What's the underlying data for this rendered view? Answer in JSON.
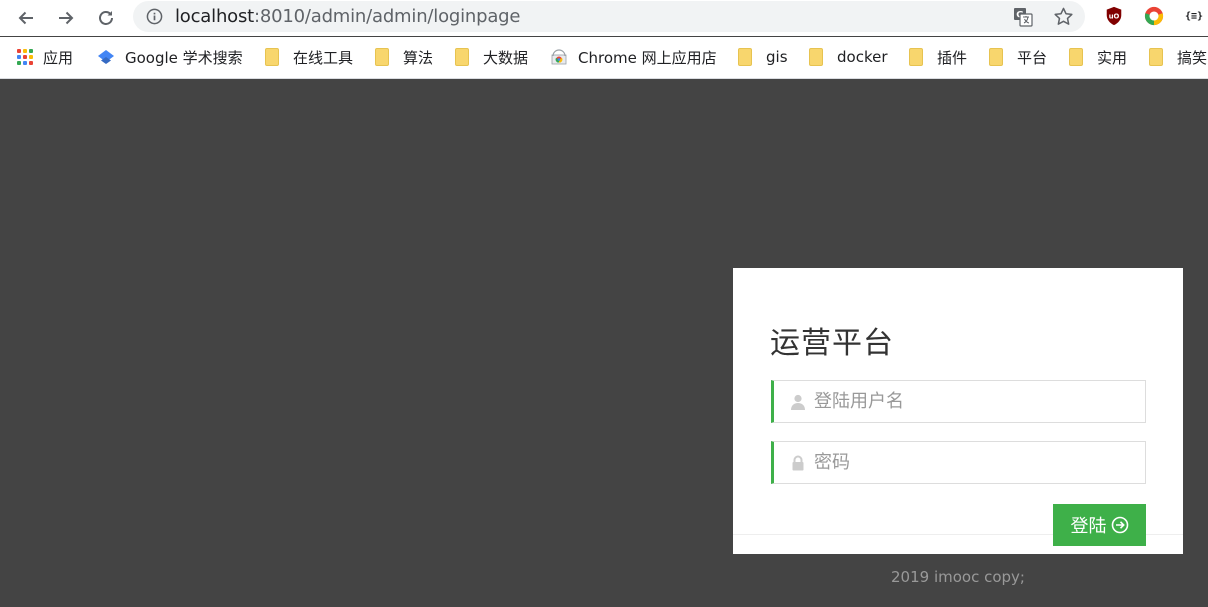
{
  "browser": {
    "url_host": "localhost",
    "url_rest": ":8010/admin/admin/loginpage",
    "icons": {
      "back": "back-arrow-icon",
      "forward": "forward-arrow-icon",
      "reload": "reload-icon",
      "info": "info-icon",
      "translate": "translate-icon",
      "star": "bookmark-star-icon",
      "ublock": "ublock-origin-icon",
      "chrome_ext": "chrome-circle-icon",
      "json_ext": "json-viewer-icon"
    },
    "json_ext_label": "{≡}"
  },
  "bookmarks": [
    {
      "label": "应用",
      "icon": "apps-grid-icon"
    },
    {
      "label": "Google 学术搜索",
      "icon": "scholar-icon"
    },
    {
      "label": "在线工具",
      "icon": "folder-icon"
    },
    {
      "label": "算法",
      "icon": "folder-icon"
    },
    {
      "label": "大数据",
      "icon": "folder-icon"
    },
    {
      "label": "Chrome 网上应用店",
      "icon": "web-store-icon"
    },
    {
      "label": "gis",
      "icon": "folder-icon"
    },
    {
      "label": "docker",
      "icon": "folder-icon"
    },
    {
      "label": "插件",
      "icon": "folder-icon"
    },
    {
      "label": "平台",
      "icon": "folder-icon"
    },
    {
      "label": "实用",
      "icon": "folder-icon"
    },
    {
      "label": "搞笑",
      "icon": "folder-icon"
    }
  ],
  "login": {
    "title": "运营平台",
    "username_placeholder": "登陆用户名",
    "password_placeholder": "密码",
    "submit_label": "登陆",
    "accent_color": "#3eb049",
    "background_color": "#444444"
  },
  "footer": {
    "copyright": "2019 imooc copy;"
  }
}
